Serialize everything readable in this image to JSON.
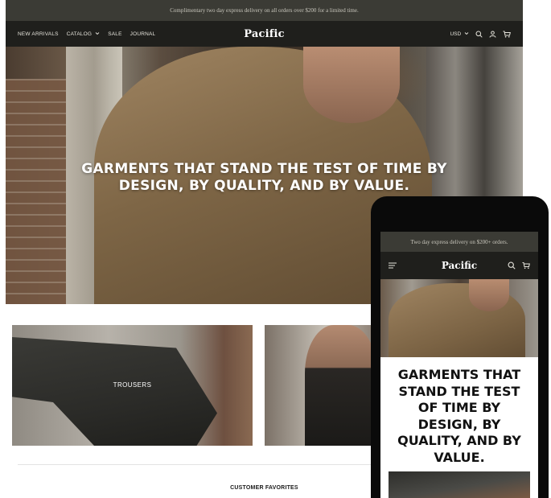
{
  "desktop": {
    "announcement": "Complimentary two day express delivery on all orders over $200 for a limited time.",
    "nav": {
      "links": [
        "NEW ARRIVALS",
        "CATALOG",
        "SALE",
        "JOURNAL"
      ],
      "brand": "Pacific",
      "currency": "USD"
    },
    "hero": {
      "line1": "GARMENTS THAT STAND THE TEST OF TIME BY",
      "line2": "DESIGN, BY QUALITY, AND BY VALUE."
    },
    "tiles": [
      {
        "label": "TROUSERS"
      }
    ],
    "section_title": "CUSTOMER FAVORITES"
  },
  "mobile": {
    "announcement": "Two day express delivery on $200+ orders.",
    "brand": "Pacific",
    "hero_title": "GARMENTS THAT STAND THE TEST OF TIME BY DESIGN, BY QUALITY, AND BY VALUE."
  },
  "icons": {
    "desktop": [
      "chevron-down-icon",
      "search-icon",
      "account-icon",
      "cart-icon"
    ],
    "mobile": [
      "menu-icon",
      "search-icon",
      "cart-icon"
    ]
  },
  "colors": {
    "announcement_bg": "#3b3b35",
    "nav_bg": "#1f1f1c",
    "text_light": "#ffffff"
  }
}
